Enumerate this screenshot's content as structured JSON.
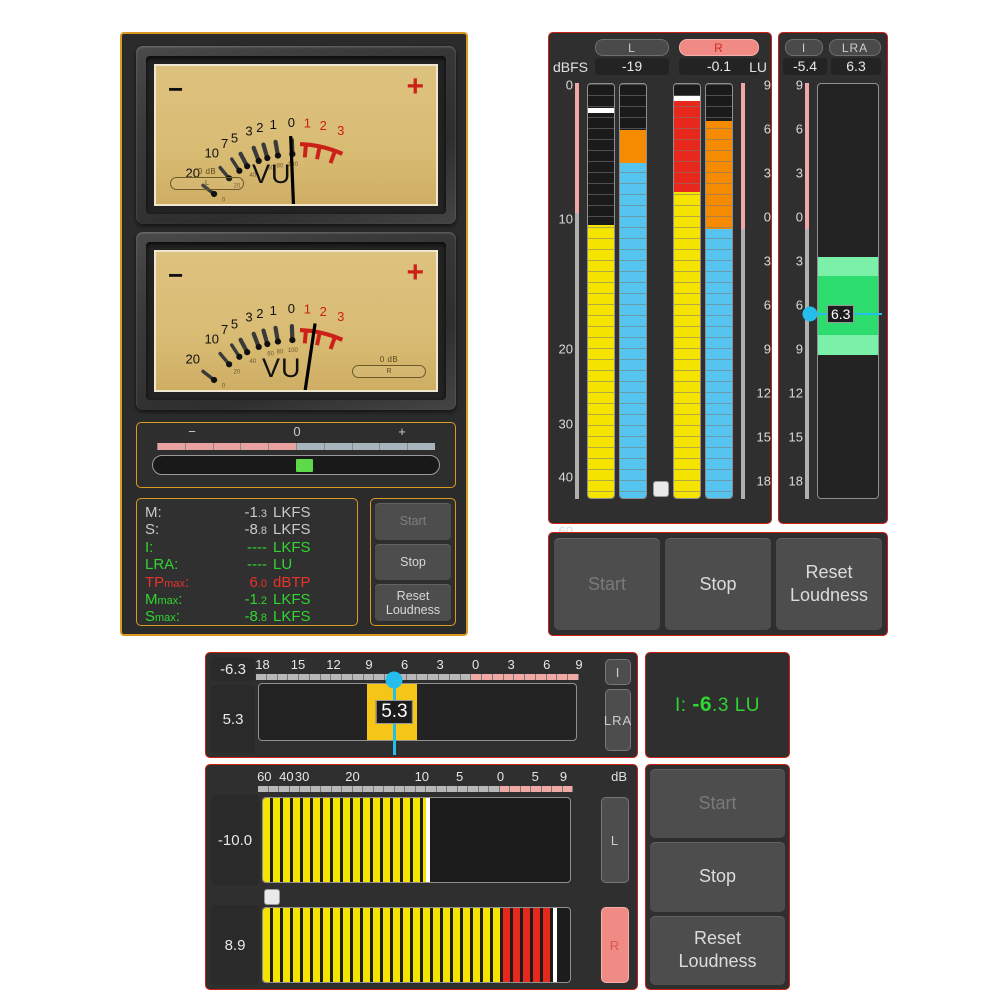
{
  "vu_meters": {
    "minus_sign": "−",
    "plus_sign": "+",
    "logo": "VU",
    "scale_major": [
      "20",
      "10",
      "7",
      "5",
      "3",
      "2",
      "1",
      "0"
    ],
    "scale_red": [
      "1",
      "2",
      "3"
    ],
    "scale_percent": [
      "0",
      "20",
      "40",
      "60",
      "80",
      "100"
    ],
    "left": {
      "pill_label": "0 dB",
      "pill_text": "L",
      "needle_value": "-1"
    },
    "right": {
      "pill_label": "0 dB",
      "pill_text": "R",
      "needle_value": "+1"
    }
  },
  "gain_slider": {
    "minus_label": "−",
    "center_label": "0",
    "plus_label": "+",
    "value_percent": 50
  },
  "loudness_readout": {
    "rows": [
      {
        "label": "M:",
        "value": "-1",
        "decimal": ".3",
        "unit": "LKFS",
        "color": "grey"
      },
      {
        "label": "S:",
        "value": "-8",
        "decimal": ".8",
        "unit": "LKFS",
        "color": "grey"
      },
      {
        "label": "I:",
        "value": "----",
        "decimal": "",
        "unit": "LKFS",
        "color": "green"
      },
      {
        "label": "LRA:",
        "value": "----",
        "decimal": "",
        "unit": "LU",
        "color": "green"
      },
      {
        "label": "TPmax:",
        "value": "6",
        "decimal": ".0",
        "unit": "dBTP",
        "color": "red",
        "sub": "max"
      },
      {
        "label": "Mmax:",
        "value": "-1",
        "decimal": ".2",
        "unit": "LKFS",
        "color": "green",
        "sub": "max"
      },
      {
        "label": "Smax:",
        "value": "-8",
        "decimal": ".8",
        "unit": "LKFS",
        "color": "green",
        "sub": "max"
      }
    ]
  },
  "transport_small": {
    "start": "Start",
    "stop": "Stop",
    "reset_line1": "Reset",
    "reset_line2": "Loudness",
    "start_disabled": true
  },
  "transport_large": {
    "start": "Start",
    "stop": "Stop",
    "reset_line1": "Reset",
    "reset_line2": "Loudness",
    "start_disabled": true
  },
  "vertical_meters": {
    "left_unit": "dBFS",
    "right_unit": "LU",
    "channels": [
      {
        "name": "L",
        "value": "-19",
        "active": false
      },
      {
        "name": "R",
        "value": "-0.1",
        "active": true
      }
    ],
    "dbfs_scale": [
      "0",
      "10",
      "20",
      "30",
      "40",
      "60"
    ],
    "lu_scale": [
      "9",
      "6",
      "3",
      "0",
      "3",
      "6",
      "9",
      "12",
      "15",
      "18"
    ],
    "bars": {
      "L_peak": {
        "color": "#f4e400",
        "level_pct": 66,
        "peak_hold_pct": 93
      },
      "L_momentary": {
        "color": "#55c5ef",
        "orange": "#f58b00",
        "level_pct": 81,
        "orange_pct": 8
      },
      "R_peak": {
        "color": "#f4e400",
        "red": "#e8281c",
        "level_pct": 96,
        "red_pct": 22,
        "peak_hold_pct": 96
      },
      "R_momentary": {
        "color": "#55c5ef",
        "orange": "#f58b00",
        "level_pct": 91,
        "orange_pct": 26
      }
    }
  },
  "ilra_panel": {
    "buttons": [
      {
        "name": "I",
        "active": false
      },
      {
        "name": "LRA",
        "active": false
      }
    ],
    "i_value": "-5.4",
    "lra_value": "6.3",
    "scale": [
      "9",
      "6",
      "3",
      "0",
      "3",
      "6",
      "9",
      "12",
      "15",
      "18"
    ],
    "range_tag": "6.3",
    "range_top_lu": 2.2,
    "range_bottom_lu": 8.6,
    "marker_lu": 6.0
  },
  "bottom_lra": {
    "scale": [
      "18",
      "15",
      "12",
      "9",
      "6",
      "3",
      "0",
      "3",
      "6",
      "9"
    ],
    "value_left": "-6.3",
    "value_bottom": "5.3",
    "range_tag": "5.3",
    "buttons": [
      {
        "name": "I",
        "active": false
      },
      {
        "name": "LRA",
        "active": false
      }
    ]
  },
  "bottom_db": {
    "unit": "dB",
    "scale": [
      "60",
      "40",
      "30",
      "20",
      "10",
      "5",
      "0",
      "5",
      "9"
    ],
    "channels": [
      {
        "name": "L",
        "value": "-10.0",
        "active": false,
        "level_pct": 53,
        "red_pct": 0,
        "peak_pct": 53
      },
      {
        "name": "R",
        "value": "8.9",
        "active": true,
        "level_pct": 94,
        "red_pct": 16,
        "peak_pct": 94
      }
    ]
  },
  "bottom_integrated": {
    "label": "I:",
    "value": "-6",
    "decimal": ".3",
    "unit": "LU"
  }
}
